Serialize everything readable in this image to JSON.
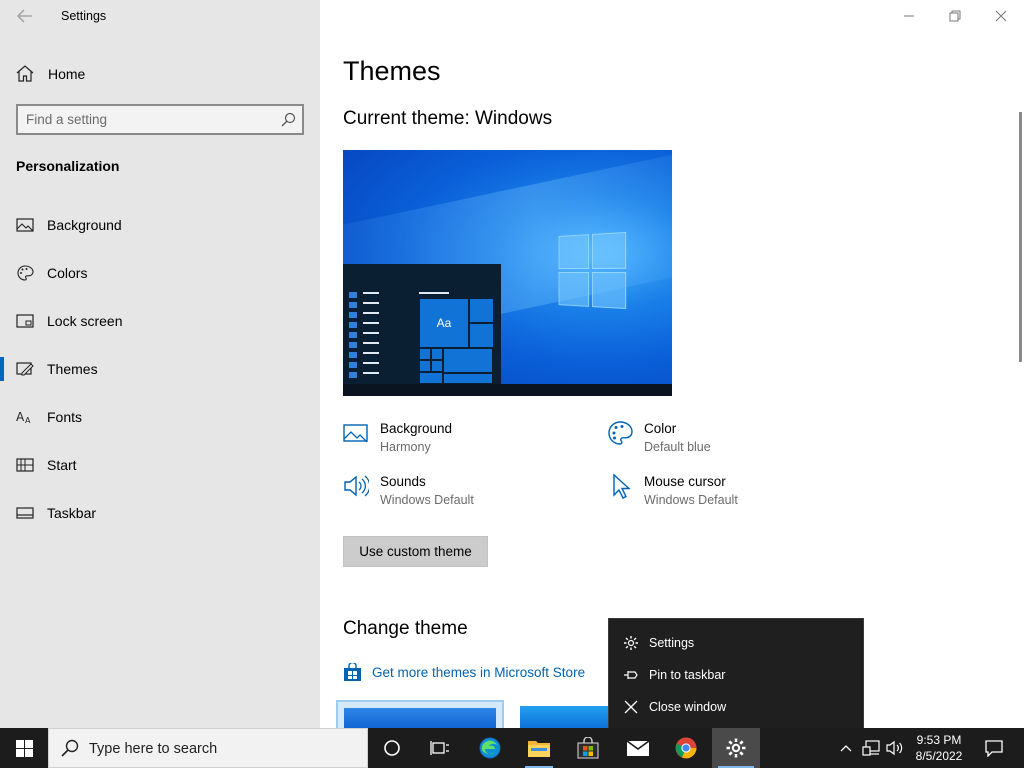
{
  "window": {
    "title": "Settings",
    "controls": {
      "minimize": "minimize-icon",
      "restore": "restore-icon",
      "close": "close-icon"
    }
  },
  "sidebar": {
    "home_label": "Home",
    "search_placeholder": "Find a setting",
    "section_title": "Personalization",
    "items": [
      {
        "label": "Background",
        "icon": "picture-icon",
        "active": false
      },
      {
        "label": "Colors",
        "icon": "palette-icon",
        "active": false
      },
      {
        "label": "Lock screen",
        "icon": "lock-screen-icon",
        "active": false
      },
      {
        "label": "Themes",
        "icon": "themes-icon",
        "active": true
      },
      {
        "label": "Fonts",
        "icon": "fonts-icon",
        "active": false
      },
      {
        "label": "Start",
        "icon": "start-icon",
        "active": false
      },
      {
        "label": "Taskbar",
        "icon": "taskbar-icon",
        "active": false
      }
    ]
  },
  "main": {
    "title": "Themes",
    "current_theme": "Current theme: Windows",
    "preview": {
      "tile_label": "Aa"
    },
    "properties": [
      {
        "name": "Background",
        "value": "Harmony",
        "icon": "picture-icon"
      },
      {
        "name": "Color",
        "value": "Default blue",
        "icon": "palette-icon"
      },
      {
        "name": "Sounds",
        "value": "Windows Default",
        "icon": "speaker-icon"
      },
      {
        "name": "Mouse cursor",
        "value": "Windows Default",
        "icon": "cursor-icon"
      }
    ],
    "custom_theme_button": "Use custom theme",
    "change_theme_title": "Change theme",
    "store_link": "Get more themes in Microsoft Store"
  },
  "context_menu": {
    "items": [
      {
        "label": "Settings",
        "icon": "gear-icon"
      },
      {
        "label": "Pin to taskbar",
        "icon": "pin-icon"
      },
      {
        "label": "Close window",
        "icon": "close-icon"
      }
    ]
  },
  "taskbar": {
    "search_placeholder": "Type here to search",
    "time": "9:53 PM",
    "date": "8/5/2022"
  },
  "colors": {
    "accent": "#0067c0",
    "link": "#0063b1",
    "sidebar_bg": "#e6e6e6",
    "taskbar_bg": "#1c1c1c",
    "menu_bg": "#1f1f1f"
  }
}
